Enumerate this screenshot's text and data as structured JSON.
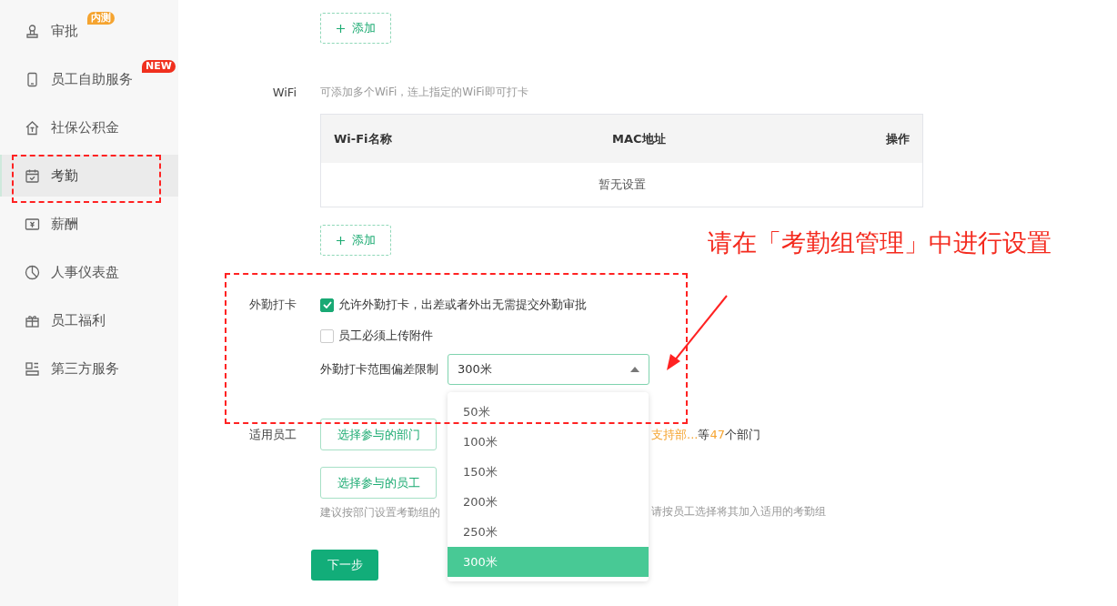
{
  "sidebar": {
    "items": [
      {
        "label": "审批",
        "selected": false,
        "badge": {
          "text": "内测",
          "color": "#f5a430"
        }
      },
      {
        "label": "员工自助服务",
        "selected": false,
        "badge": {
          "text": "NEW",
          "color": "#f0301e"
        }
      },
      {
        "label": "社保公积金",
        "selected": false
      },
      {
        "label": "考勤",
        "selected": true
      },
      {
        "label": "薪酬",
        "selected": false
      },
      {
        "label": "人事仪表盘",
        "selected": false
      },
      {
        "label": "员工福利",
        "selected": false
      },
      {
        "label": "第三方服务",
        "selected": false
      }
    ]
  },
  "top_add_button": "添加",
  "wifi": {
    "label": "WiFi",
    "hint": "可添加多个WiFi，连上指定的WiFi即可打卡",
    "table": {
      "columns": [
        "Wi-Fi名称",
        "MAC地址",
        "操作"
      ],
      "empty_text": "暂无设置"
    },
    "add_button": "添加"
  },
  "outside_checkin": {
    "label": "外勤打卡",
    "options": [
      {
        "label": "允许外勤打卡，出差或者外出无需提交外勤审批",
        "checked": true
      },
      {
        "label": "员工必须上传附件",
        "checked": false
      }
    ],
    "range": {
      "label": "外勤打卡范围偏差限制",
      "value": "300米",
      "expanded": true,
      "options": [
        {
          "label": "50米",
          "selected": false
        },
        {
          "label": "100米",
          "selected": false
        },
        {
          "label": "150米",
          "selected": false
        },
        {
          "label": "200米",
          "selected": false
        },
        {
          "label": "250米",
          "selected": false
        },
        {
          "label": "300米",
          "selected": true
        }
      ]
    }
  },
  "applicable": {
    "label": "适用员工",
    "dept_button": "选择参与的部门",
    "dept_summary": [
      {
        "text": "支持部...",
        "highlight": true
      },
      {
        "text": "等",
        "highlight": false
      },
      {
        "text": "47",
        "highlight": true
      },
      {
        "text": "个部门",
        "highlight": false
      }
    ],
    "staff_button": "选择参与的员工",
    "hint_parts": [
      "建议按部门设置考勤组的",
      "请按员工选择将其加入适用的考勤组"
    ]
  },
  "next_button": "下一步",
  "annotation": {
    "text": "请在「考勤组管理」中进行设置"
  }
}
